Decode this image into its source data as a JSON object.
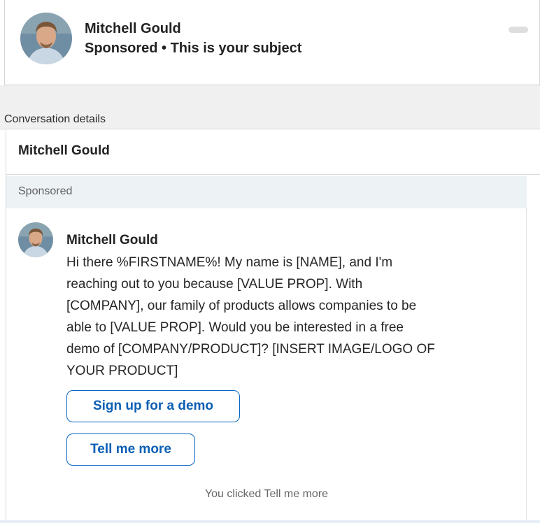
{
  "preview": {
    "sender_name": "Mitchell Gould",
    "subtitle": "Sponsored • This is your subject"
  },
  "conversation": {
    "section_label": "Conversation details",
    "header_name": "Mitchell Gould",
    "sponsored_label": "Sponsored",
    "message": {
      "sender_name": "Mitchell Gould",
      "body_lines": [
        "Hi there %FIRSTNAME%! My name is [NAME], and I'm",
        "reaching out to you because [VALUE PROP]. With",
        "[COMPANY], our family of products allows companies to be",
        "able to [VALUE PROP]. Would you be interested in a free",
        "demo of [COMPANY/PRODUCT]? [INSERT IMAGE/LOGO OF",
        "YOUR PRODUCT]"
      ]
    },
    "buttons": {
      "demo_label": "Sign up for a demo",
      "more_label": "Tell me more"
    },
    "clicked_note": "You clicked Tell me more"
  },
  "colors": {
    "accent": "#0a66c2",
    "sponsored_bg": "#edf2f4"
  }
}
